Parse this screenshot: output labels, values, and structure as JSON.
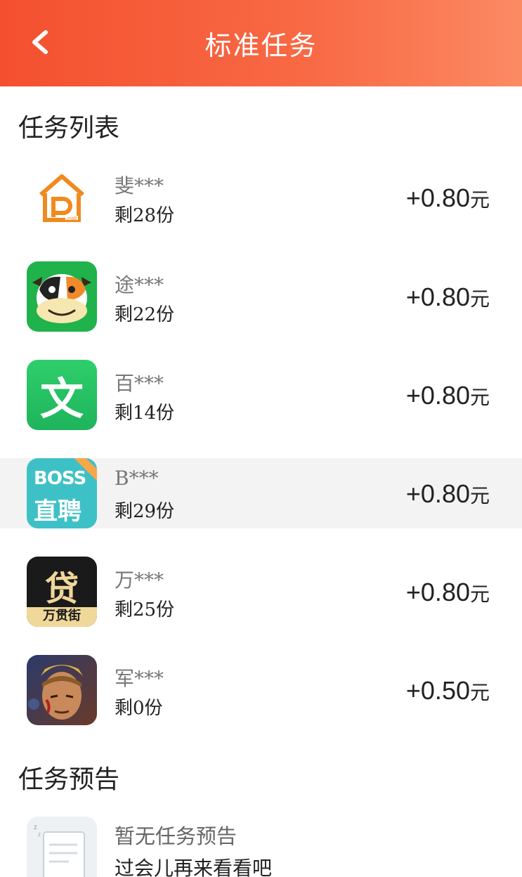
{
  "header": {
    "title": "标准任务",
    "back_icon": "chevron-left-icon",
    "gradient_start": "#f4502f",
    "gradient_end": "#fb8a63"
  },
  "sections": {
    "task_list_title": "任务列表",
    "preview_title": "任务预告"
  },
  "tasks": [
    {
      "name": "斐***",
      "remaining": "剩28份",
      "reward": "+0.80",
      "unit": "元",
      "icon": "pmall-house-icon"
    },
    {
      "name": "途***",
      "remaining": "剩22份",
      "reward": "+0.80",
      "unit": "元",
      "icon": "cow-face-icon"
    },
    {
      "name": "百***",
      "remaining": "剩14份",
      "reward": "+0.80",
      "unit": "元",
      "icon": "wen-document-icon",
      "icon_text": "文"
    },
    {
      "name": "B***",
      "remaining": "剩29份",
      "reward": "+0.80",
      "unit": "元",
      "icon": "boss-zhipin-icon",
      "icon_text_top": "BOSS",
      "icon_text_bottom": "直聘"
    },
    {
      "name": "万***",
      "remaining": "剩25份",
      "reward": "+0.80",
      "unit": "元",
      "icon": "wandaijie-loan-icon",
      "icon_text_top": "贷",
      "icon_text_bottom": "万贯街"
    },
    {
      "name": "军***",
      "remaining": "剩0份",
      "reward": "+0.50",
      "unit": "元",
      "icon": "game-hero-icon"
    }
  ],
  "preview": {
    "title": "暂无任务预告",
    "subtitle": "过会儿再来看看吧",
    "icon": "sleeping-document-icon"
  }
}
